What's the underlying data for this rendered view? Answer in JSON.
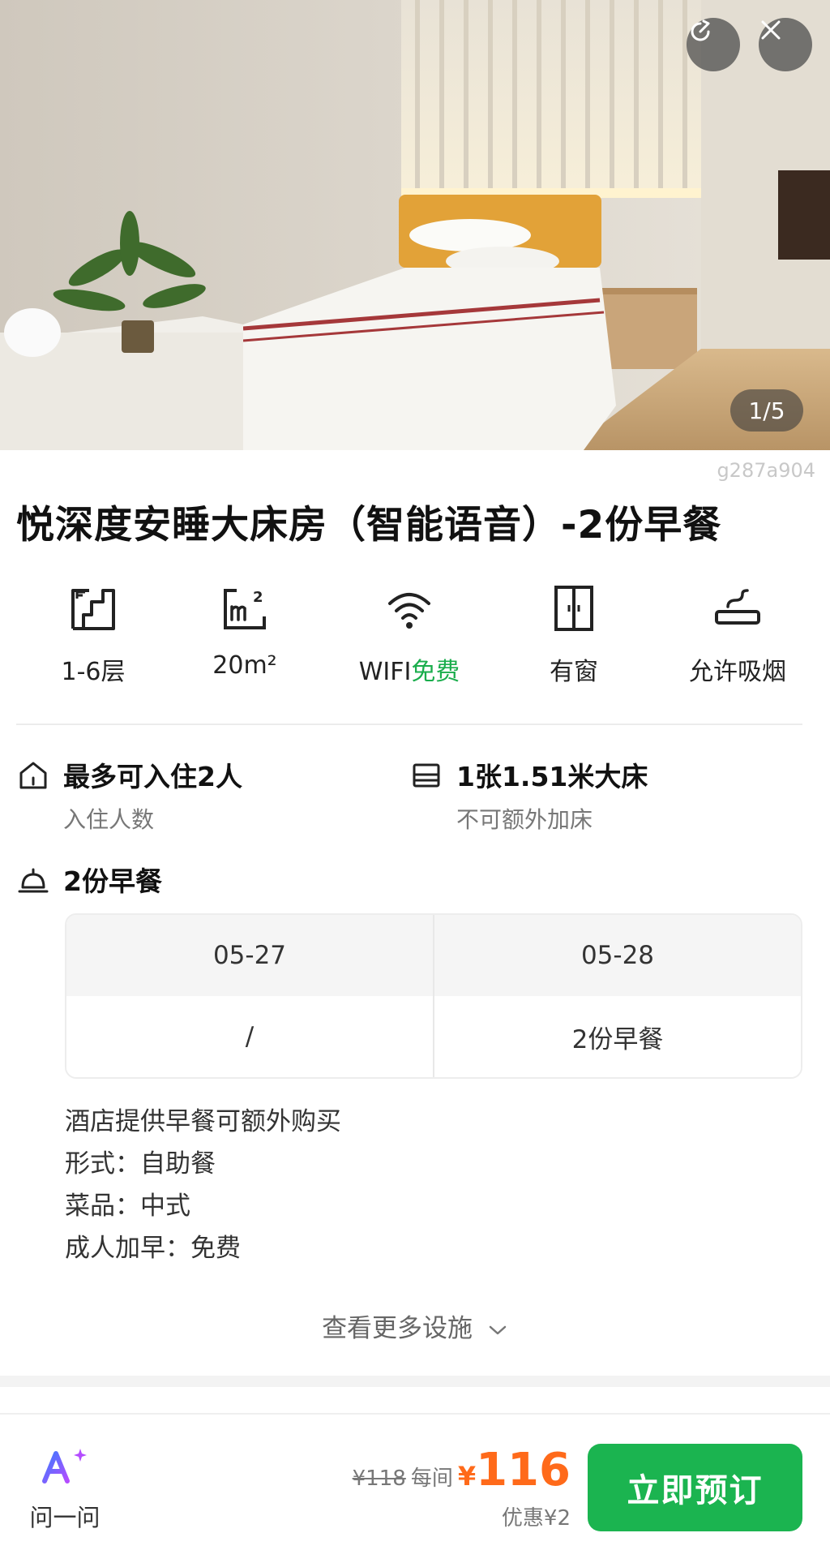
{
  "hero": {
    "counter": "1/5",
    "buttons": {
      "share_icon": "share-icon",
      "close_icon": "close-icon"
    }
  },
  "watermark_code": "g287a904",
  "room_title": "悦深度安睡大床房（智能语音）-2份早餐",
  "facilities": [
    {
      "icon": "floor-icon",
      "label": "1-6层"
    },
    {
      "icon": "area-icon",
      "label": "20m²"
    },
    {
      "icon": "wifi-icon",
      "label_prefix": "WIFI",
      "label_suffix": "免费"
    },
    {
      "icon": "window-icon",
      "label": "有窗"
    },
    {
      "icon": "smoking-icon",
      "label": "允许吸烟"
    }
  ],
  "info": {
    "occupancy": {
      "main": "最多可入住2人",
      "sub": "入住人数"
    },
    "bed": {
      "main": "1张1.51米大床",
      "sub": "不可额外加床"
    },
    "breakfast": {
      "main": "2份早餐"
    }
  },
  "breakfast_table": {
    "dates": [
      "05-27",
      "05-28"
    ],
    "values": [
      "/",
      "2份早餐"
    ]
  },
  "breakfast_notes": [
    "酒店提供早餐可额外购买",
    "形式：自助餐",
    "菜品：中式",
    "成人加早：免费"
  ],
  "more_facilities": "查看更多设施",
  "bottom_bar": {
    "ask_label": "问一问",
    "original_price": "¥118",
    "per_night": "每间",
    "currency": "¥",
    "price": "116",
    "discount": "优惠¥2",
    "book_label": "立即预订"
  },
  "colors": {
    "accent_green": "#1bb450",
    "price_orange": "#ff6a1a"
  }
}
